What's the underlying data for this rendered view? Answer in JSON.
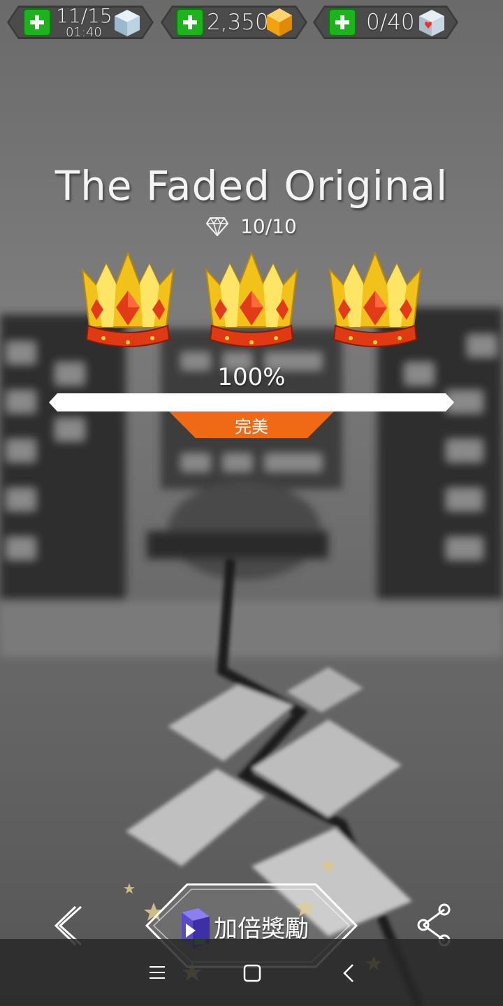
{
  "top_bar": {
    "energy": {
      "value": "11/15",
      "timer": "01:40",
      "plus_icon": "plus-icon",
      "icon": "blue-cube-icon"
    },
    "gems": {
      "value": "2,350",
      "plus_icon": "plus-icon",
      "icon": "orange-gem-icon"
    },
    "hearts": {
      "value": "0/40",
      "plus_icon": "plus-icon",
      "icon": "heart-cube-icon"
    }
  },
  "result": {
    "title": "The Faded Original",
    "diamonds": "10/10",
    "crowns_earned": 3,
    "crowns_total": 3,
    "percent": "100%",
    "progress_fraction": 1.0,
    "rating": "完美"
  },
  "actions": {
    "back_icon": "chevron-left-icon",
    "reward_button": "加倍獎勵",
    "reward_icon": "ad-video-icon",
    "share_icon": "share-icon"
  },
  "system_nav": {
    "menu_icon": "menu-icon",
    "home_icon": "home-icon",
    "back_icon": "back-icon"
  },
  "colors": {
    "accent_orange": "#f06a15",
    "plus_green": "#1db31d",
    "crown_gold": "#f2c21a",
    "crown_red": "#e23b1a"
  }
}
